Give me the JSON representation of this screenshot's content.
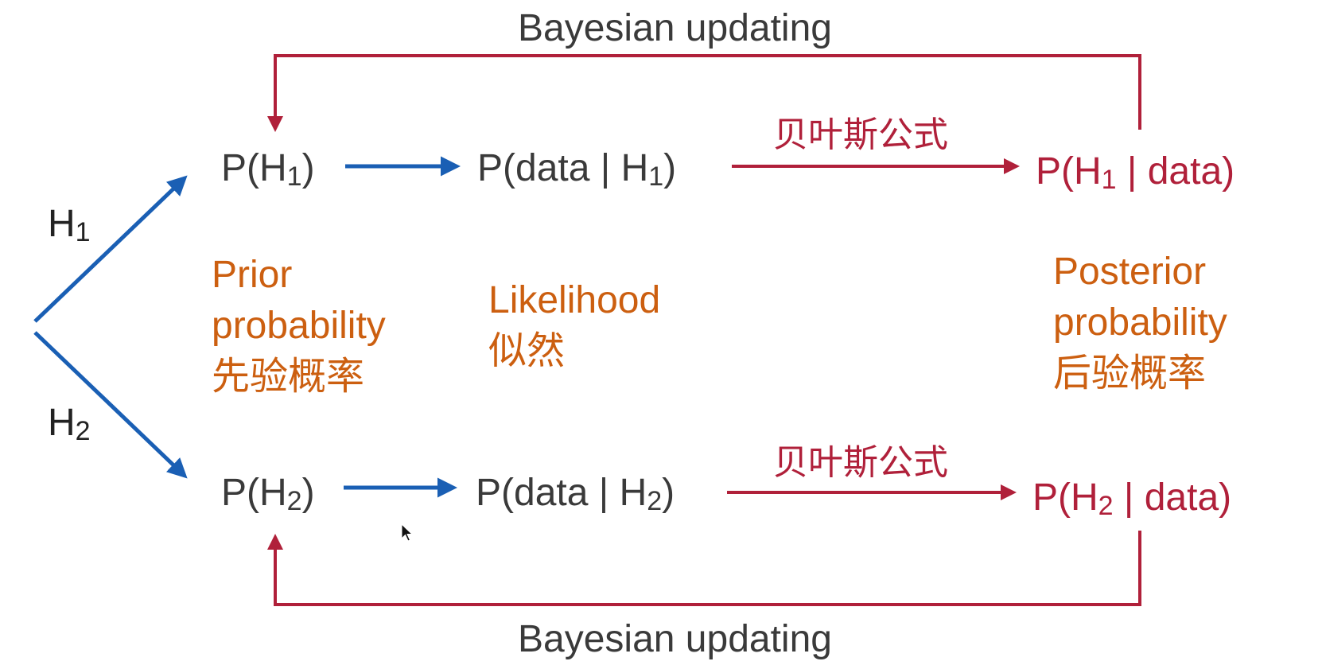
{
  "diagram": {
    "bayesian_top": "Bayesian updating",
    "bayesian_bottom": "Bayesian updating",
    "h1_branch_label": {
      "letter": "H",
      "index": "1"
    },
    "h2_branch_label": {
      "letter": "H",
      "index": "2"
    },
    "row1": {
      "prior": {
        "pre": "P(H",
        "sub": "1",
        "post": ")"
      },
      "likelihood": {
        "pre": "P(data | H",
        "sub": "1",
        "post": ")"
      },
      "formula": "贝叶斯公式",
      "posterior": {
        "pre": "P(H",
        "sub": "1",
        "post": " | data)"
      }
    },
    "row2": {
      "prior": {
        "pre": "P(H",
        "sub": "2",
        "post": ")"
      },
      "likelihood": {
        "pre": "P(data | H",
        "sub": "2",
        "post": ")"
      },
      "formula": "贝叶斯公式",
      "posterior": {
        "pre": "P(H",
        "sub": "2",
        "post": " | data)"
      }
    },
    "prior_desc": [
      "Prior",
      "probability",
      "先验概率"
    ],
    "likelihood_desc": [
      "Likelihood",
      "似然"
    ],
    "posterior_desc": [
      "Posterior",
      "probability",
      "后验概率"
    ]
  },
  "colors": {
    "blue_arrow": "#1a5fb4",
    "red_arrow": "#b0203a",
    "orange_text": "#cc5f10",
    "gray_text": "#3a3a3a"
  }
}
